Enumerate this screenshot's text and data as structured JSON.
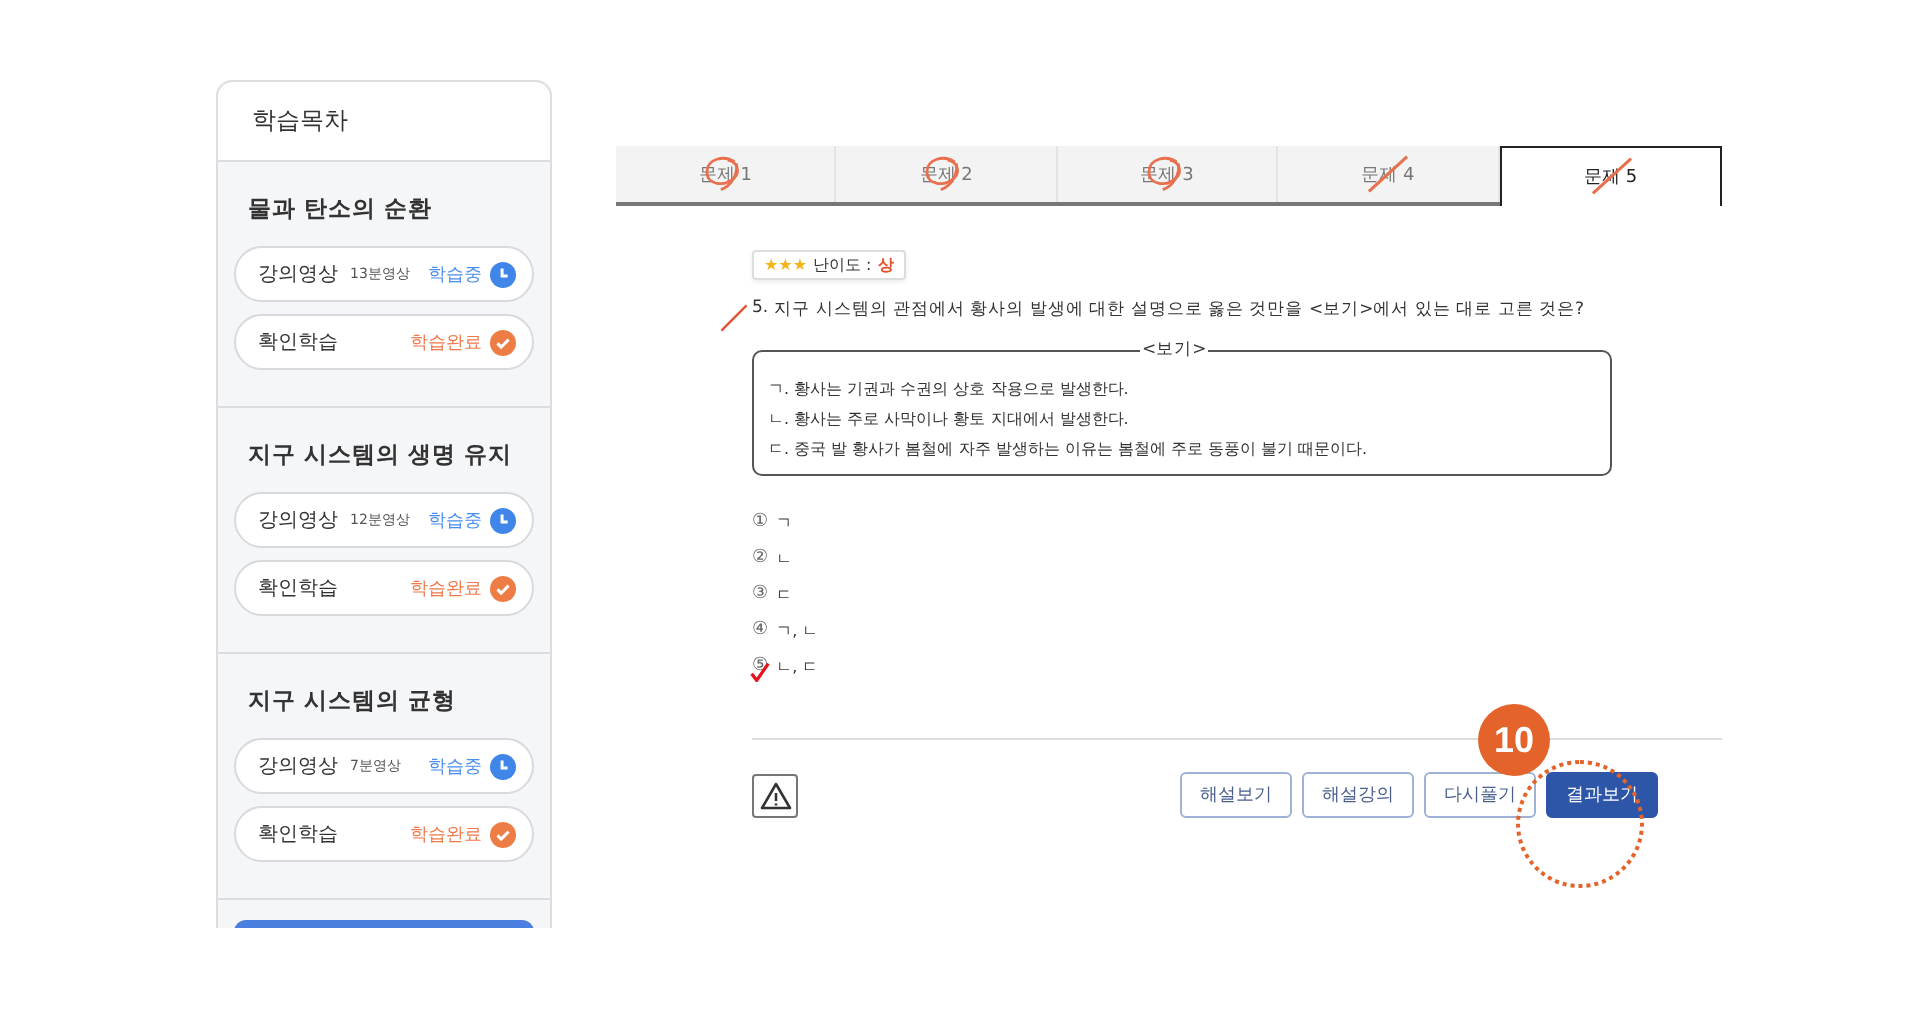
{
  "sidebar": {
    "title": "학습목차",
    "sections": [
      {
        "title": "물과 탄소의 순환",
        "items": [
          {
            "kind": "video",
            "label": "강의영상",
            "duration": "13분영상",
            "status_text": "학습중",
            "completed": false
          },
          {
            "kind": "quiz",
            "label": "확인학습",
            "status_text": "학습완료",
            "completed": true
          }
        ]
      },
      {
        "title": "지구 시스템의 생명 유지",
        "items": [
          {
            "kind": "video",
            "label": "강의영상",
            "duration": "12분영상",
            "status_text": "학습중",
            "completed": false
          },
          {
            "kind": "quiz",
            "label": "확인학습",
            "status_text": "학습완료",
            "completed": true
          }
        ]
      },
      {
        "title": "지구 시스템의 균형",
        "items": [
          {
            "kind": "video",
            "label": "강의영상",
            "duration": "7분영상",
            "status_text": "학습중",
            "completed": false
          },
          {
            "kind": "quiz",
            "label": "확인학습",
            "status_text": "학습완료",
            "completed": true
          }
        ]
      }
    ]
  },
  "tabs": [
    {
      "label": "문제 1",
      "selected": false,
      "correct": true
    },
    {
      "label": "문제 2",
      "selected": false,
      "correct": true
    },
    {
      "label": "문제 3",
      "selected": false,
      "correct": true
    },
    {
      "label": "문제 4",
      "selected": false,
      "correct": false
    },
    {
      "label": "문제 5",
      "selected": true,
      "correct": false
    }
  ],
  "question": {
    "stars": 3,
    "difficulty_label": "난이도 :",
    "difficulty": "상",
    "number": "5.",
    "correct": false,
    "text": "지구 시스템의 관점에서 황사의 발생에 대한 설명으로 옳은 것만을 <보기>에서 있는 대로 고른 것은?",
    "box_title": "<보기>",
    "box_lines": [
      "ㄱ. 황사는 기권과 수권의 상호 작용으로 발생한다.",
      "ㄴ. 황사는 주로 사막이나 황토 지대에서 발생한다.",
      "ㄷ. 중국 발 황사가 봄철에 자주 발생하는 이유는 봄철에 주로 동풍이 불기 때문이다."
    ],
    "choices": [
      {
        "number": "①",
        "text": "ㄱ",
        "selected": false
      },
      {
        "number": "②",
        "text": "ㄴ",
        "selected": false
      },
      {
        "number": "③",
        "text": "ㄷ",
        "selected": false
      },
      {
        "number": "④",
        "text": "ㄱ, ㄴ",
        "selected": false
      },
      {
        "number": "⑤",
        "text": "ㄴ, ㄷ",
        "selected": true
      }
    ]
  },
  "buttons": [
    {
      "label": "해설보기",
      "primary": false
    },
    {
      "label": "해설강의",
      "primary": false
    },
    {
      "label": "다시풀기",
      "primary": false
    },
    {
      "label": "결과보기",
      "primary": true
    }
  ],
  "callout": {
    "number": "10"
  }
}
